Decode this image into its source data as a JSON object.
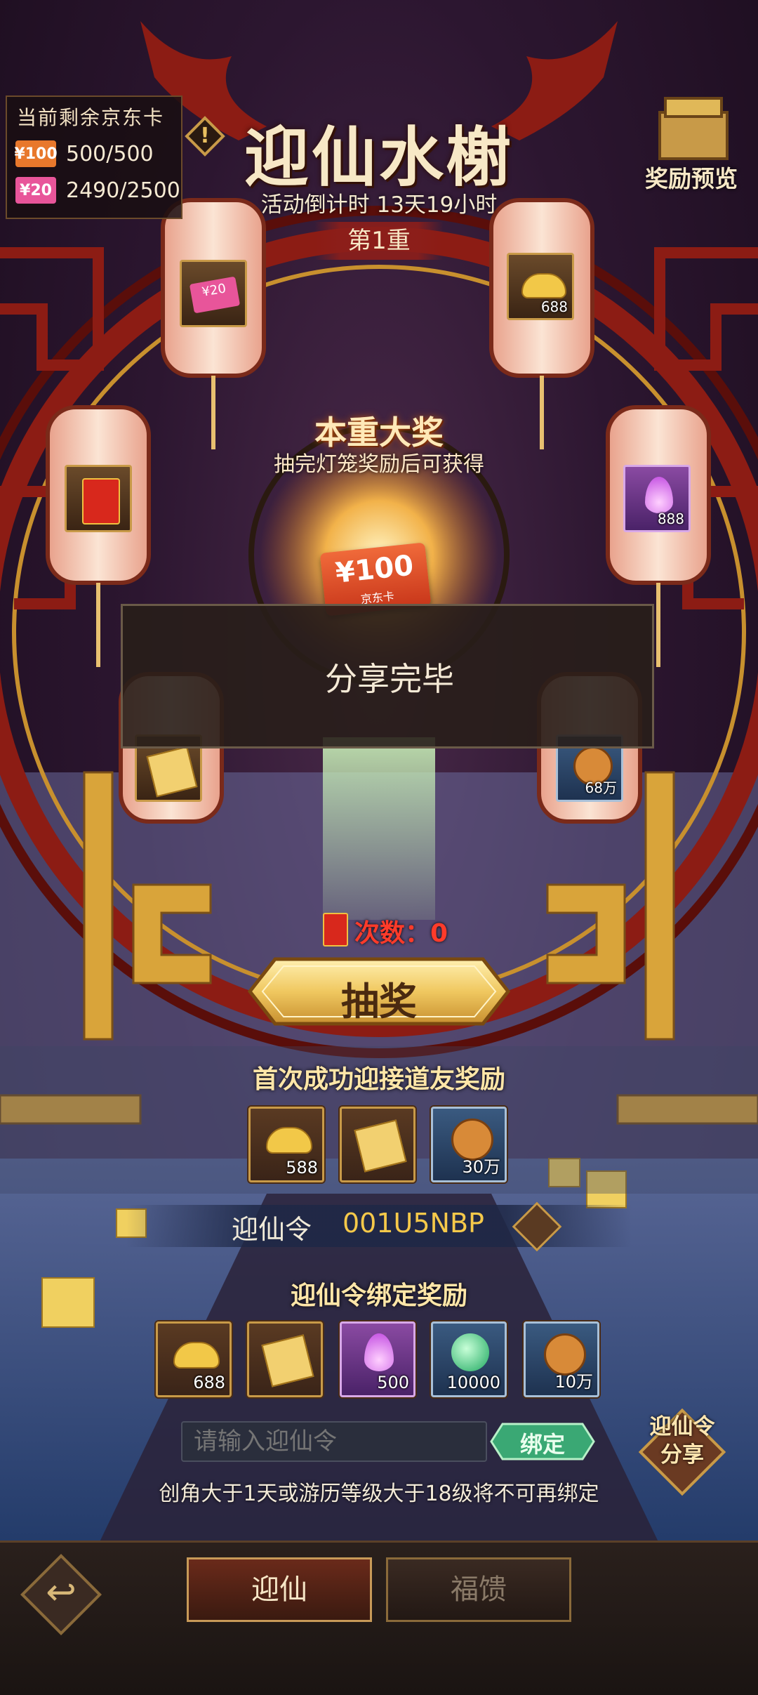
{
  "card_panel": {
    "title": "当前剩余京东卡",
    "cards": [
      {
        "chip": "¥100",
        "value": "500/500",
        "color": "#e8782c"
      },
      {
        "chip": "¥20",
        "value": "2490/2500",
        "color": "#e8559a"
      }
    ]
  },
  "header": {
    "title": "迎仙水榭",
    "countdown": "活动倒计时 13天19小时",
    "tier": "第1重",
    "preview_label": "奖励预览"
  },
  "grand_prize": {
    "title": "本重大奖",
    "subtitle": "抽完灯笼奖励后可获得",
    "card_text": "¥100",
    "card_sub": "京东卡"
  },
  "lanterns": [
    {
      "icon": "jd-card-20-icon",
      "chip": "¥20",
      "count": ""
    },
    {
      "icon": "gold-ingot-icon",
      "count": "688"
    },
    {
      "icon": "red-envelope-icon",
      "count": ""
    },
    {
      "icon": "purple-flame-icon",
      "count": "888"
    },
    {
      "icon": "gold-ticket-icon",
      "count": ""
    },
    {
      "icon": "copper-coin-icon",
      "count": "68万"
    }
  ],
  "toast": {
    "text": "分享完毕"
  },
  "draw": {
    "count_label": "次数：0",
    "button_label": "抽奖"
  },
  "first_reward": {
    "title": "首次成功迎接道友奖励",
    "items": [
      {
        "icon": "gold-ingot-icon",
        "count": "588",
        "style": "gold"
      },
      {
        "icon": "gold-ticket-icon",
        "count": "",
        "style": "gold"
      },
      {
        "icon": "copper-coin-icon",
        "count": "30万",
        "style": "blue"
      }
    ]
  },
  "invite_code": {
    "label": "迎仙令",
    "value": "001U5NBP"
  },
  "bind_reward": {
    "title": "迎仙令绑定奖励",
    "items": [
      {
        "icon": "gold-ingot-icon",
        "count": "688",
        "style": "gold"
      },
      {
        "icon": "gold-ticket-icon",
        "count": "",
        "style": "gold"
      },
      {
        "icon": "purple-flame-icon",
        "count": "500",
        "style": "purple"
      },
      {
        "icon": "green-orb-icon",
        "count": "10000",
        "style": "blue"
      },
      {
        "icon": "copper-coin-icon",
        "count": "10万",
        "style": "blue"
      }
    ],
    "input_placeholder": "请输入迎仙令",
    "bind_button": "绑定",
    "warning": "创角大于1天或游历等级大于18级将不可再绑定"
  },
  "share_code_button": "迎仙令分享",
  "bottom_tabs": [
    {
      "label": "迎仙",
      "active": true
    },
    {
      "label": "福馈",
      "active": false
    }
  ],
  "colors": {
    "gold": "#e9b955",
    "red_frame": "#8c1c14",
    "accent_text": "#f6c94a"
  }
}
